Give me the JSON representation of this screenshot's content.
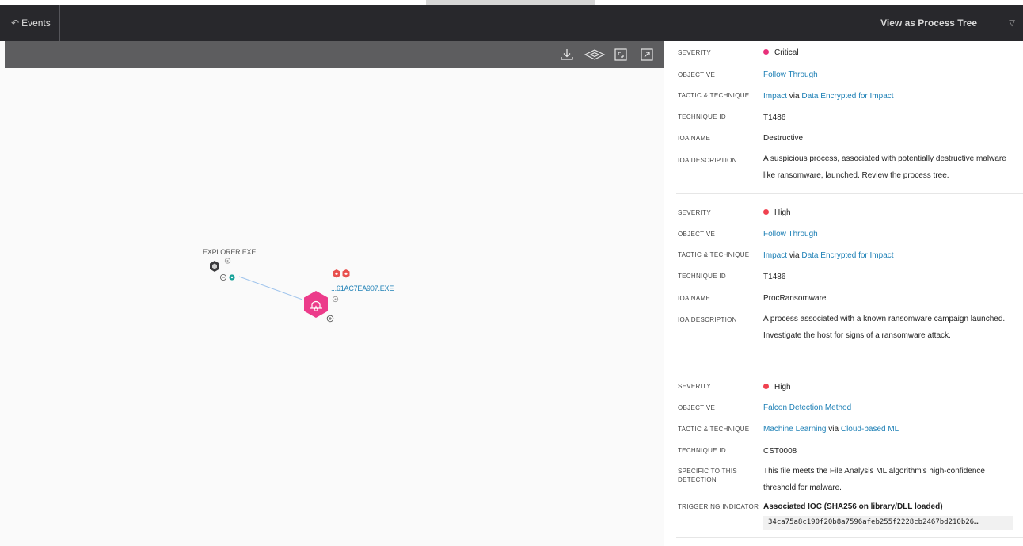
{
  "header": {
    "back_label": "Events",
    "view_as_label": "View as Process Tree"
  },
  "graph": {
    "nodes": [
      {
        "label": "EXPLORER.EXE"
      },
      {
        "label": "...61AC7EA907.EXE"
      }
    ]
  },
  "detections": [
    {
      "severity_label": "SEVERITY",
      "severity": "Critical",
      "severity_color": "#e8307a",
      "objective_label": "OBJECTIVE",
      "objective": "Follow Through",
      "tactic_label": "TACTIC & TECHNIQUE",
      "tactic": "Impact",
      "via": "via",
      "technique": "Data Encrypted for Impact",
      "technique_id_label": "TECHNIQUE ID",
      "technique_id": "T1486",
      "ioa_name_label": "IOA NAME",
      "ioa_name": "Destructive",
      "ioa_desc_label": "IOA DESCRIPTION",
      "ioa_desc": "A suspicious process, associated with potentially destructive malware like ransomware, launched. Review the process tree."
    },
    {
      "severity_label": "SEVERITY",
      "severity": "High",
      "severity_color": "#f0414f",
      "objective_label": "OBJECTIVE",
      "objective": "Follow Through",
      "tactic_label": "TACTIC & TECHNIQUE",
      "tactic": "Impact",
      "via": "via",
      "technique": "Data Encrypted for Impact",
      "technique_id_label": "TECHNIQUE ID",
      "technique_id": "T1486",
      "ioa_name_label": "IOA NAME",
      "ioa_name": "ProcRansomware",
      "ioa_desc_label": "IOA DESCRIPTION",
      "ioa_desc": "A process associated with a known ransomware campaign launched. Investigate the host for signs of a ransomware attack."
    },
    {
      "severity_label": "SEVERITY",
      "severity": "High",
      "severity_color": "#f0414f",
      "objective_label": "OBJECTIVE",
      "objective": "Falcon Detection Method",
      "tactic_label": "TACTIC & TECHNIQUE",
      "tactic": "Machine Learning",
      "via": "via",
      "technique": "Cloud-based ML",
      "technique_id_label": "TECHNIQUE ID",
      "technique_id": "CST0008",
      "specific_label": "SPECIFIC TO THIS DETECTION",
      "specific": "This file meets the File Analysis ML algorithm's high-confidence threshold for malware.",
      "trigger_label": "TRIGGERING INDICATOR",
      "trigger_title": "Associated IOC (SHA256 on library/DLL loaded)",
      "trigger_hash": "34ca75a8c190f20b8a7596afeb255f2228cb2467bd210b26…"
    }
  ]
}
